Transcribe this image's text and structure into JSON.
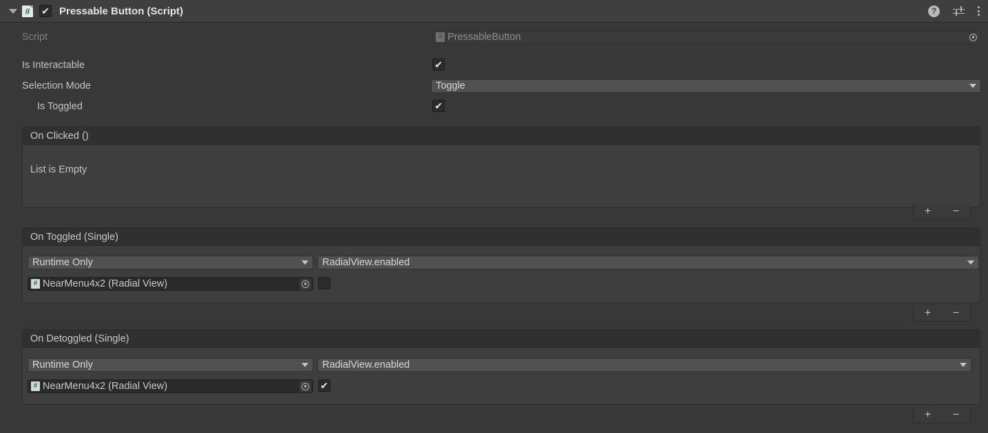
{
  "header": {
    "title": "Pressable Button (Script)",
    "enabled_checkbox": "✔",
    "foldout": "expanded",
    "script_glyph": "#",
    "help_icon": "?",
    "tools": [
      "help-icon",
      "preset-icon",
      "more-menu-icon"
    ]
  },
  "properties": {
    "script": {
      "label": "Script",
      "value": "PressableButton",
      "glyph": "#",
      "disabled": true
    },
    "is_interactable": {
      "label": "Is Interactable",
      "checked": true,
      "mark": "✔"
    },
    "selection_mode": {
      "label": "Selection Mode",
      "value": "Toggle"
    },
    "is_toggled": {
      "label": "Is Toggled",
      "checked": true,
      "mark": "✔"
    }
  },
  "events": [
    {
      "title": "On Clicked ()",
      "empty_text": "List is Empty",
      "entries": [],
      "add_label": "+",
      "remove_label": "−"
    },
    {
      "title": "On Toggled (Single)",
      "empty_text": "",
      "entries": [
        {
          "call_state": "Runtime Only",
          "function": "RadialView.enabled",
          "target": "NearMenu4x2 (Radial View)",
          "target_glyph": "#",
          "argument_checked": false,
          "argument_mark": ""
        }
      ],
      "add_label": "+",
      "remove_label": "−"
    },
    {
      "title": "On Detoggled (Single)",
      "empty_text": "",
      "entries": [
        {
          "call_state": "Runtime Only",
          "function": "RadialView.enabled",
          "target": "NearMenu4x2 (Radial View)",
          "target_glyph": "#",
          "argument_checked": true,
          "argument_mark": "✔"
        }
      ],
      "add_label": "+",
      "remove_label": "−"
    }
  ],
  "colors": {
    "background": "#383838",
    "header_bg": "#3f3f3f",
    "event_body": "#3e3e3e",
    "event_header": "#303030",
    "field_dark": "#2a2a2a",
    "dropdown_bg": "#515151",
    "text": "#c9c9c9",
    "text_dim": "#7f7f7f",
    "script_green": "#1f7a36"
  }
}
